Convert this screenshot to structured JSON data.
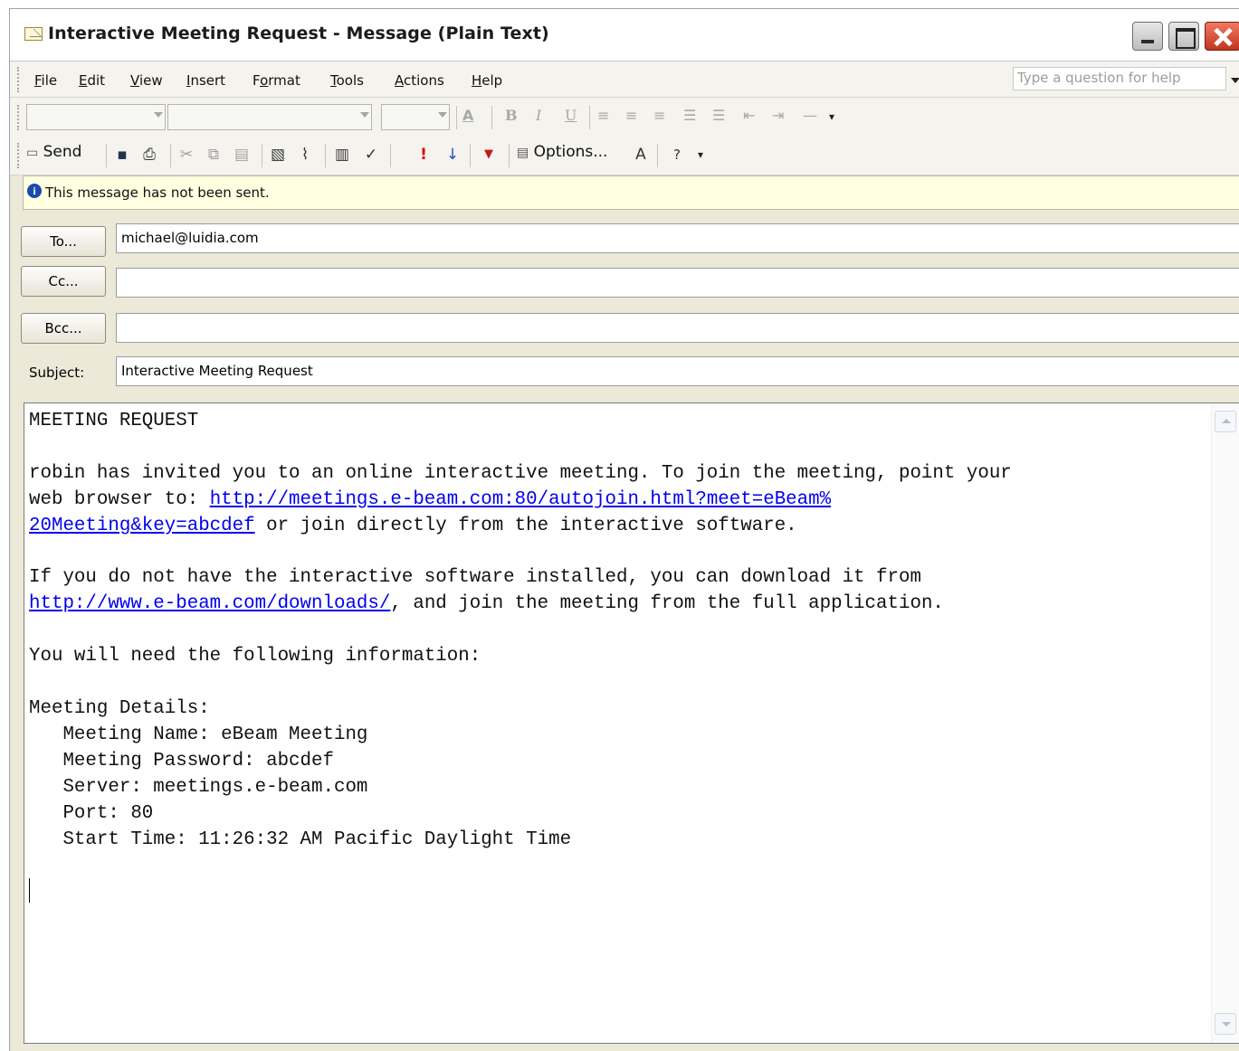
{
  "window": {
    "title": "Interactive Meeting Request - Message (Plain Text)"
  },
  "menu": [
    {
      "label": "File",
      "key": "F"
    },
    {
      "label": "Edit",
      "key": "E"
    },
    {
      "label": "View",
      "key": "V"
    },
    {
      "label": "Insert",
      "key": "I"
    },
    {
      "label": "Format",
      "key": "o"
    },
    {
      "label": "Tools",
      "key": "T"
    },
    {
      "label": "Actions",
      "key": "A"
    },
    {
      "label": "Help",
      "key": "H"
    }
  ],
  "help_box": {
    "placeholder": "Type a question for help"
  },
  "toolbar": {
    "send_label": "Send",
    "options_label": "Options..."
  },
  "infobar": {
    "text": "This message has not been sent."
  },
  "fields": {
    "to_label": "To...",
    "to_value": "michael@luidia.com",
    "cc_label": "Cc...",
    "cc_value": "",
    "bcc_label": "Bcc...",
    "bcc_value": "",
    "subject_label": "Subject:",
    "subject_value": "Interactive Meeting Request"
  },
  "body": {
    "heading": "MEETING REQUEST",
    "invite_line1": "robin has invited you to an online interactive meeting. To join the meeting, point your",
    "invite_line2_prefix": "web browser to: ",
    "join_link_part1": "http://meetings.e-beam.com:80/autojoin.html?meet=eBeam%",
    "join_link_part2": "20Meeting&key=abcdef",
    "invite_line3_suffix": " or join directly from the interactive software.",
    "download_line1": "If you do not have the interactive software installed, you can download it from",
    "download_link": "http://www.e-beam.com/downloads/",
    "download_line2_suffix": ", and join the meeting from the full application.",
    "need_info": "You will need the following information:",
    "details_heading": "Meeting Details:",
    "detail_name": "   Meeting Name: eBeam Meeting",
    "detail_password": "   Meeting Password: abcdef",
    "detail_server": "   Server: meetings.e-beam.com",
    "detail_port": "   Port: 80",
    "detail_start": "   Start Time: 11:26:32 AM Pacific Daylight Time"
  }
}
